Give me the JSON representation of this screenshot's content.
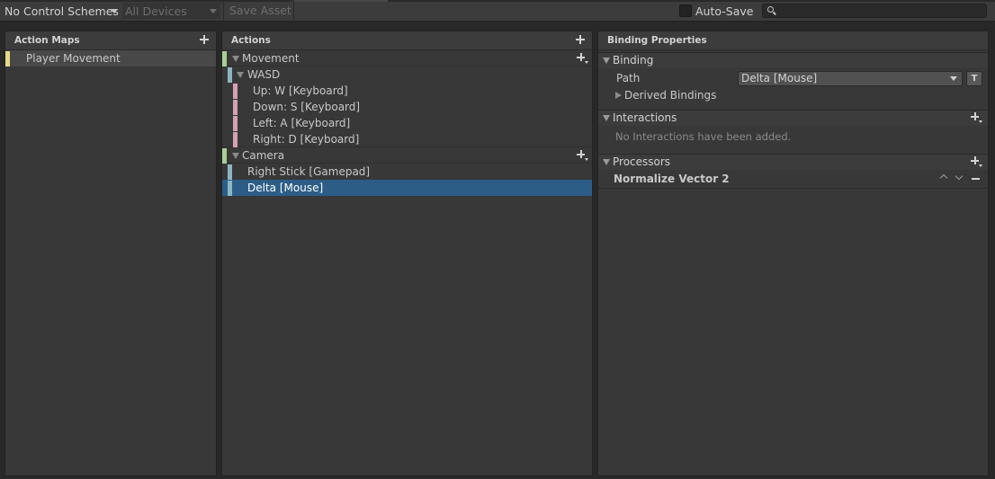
{
  "toolbar": {
    "control_scheme": "No Control Schemes",
    "devices": "All Devices",
    "save_asset": "Save Asset",
    "auto_save": "Auto-Save",
    "search_placeholder": ""
  },
  "action_maps": {
    "title": "Action Maps",
    "items": [
      {
        "label": "Player Movement",
        "color": "#e8d98a"
      }
    ]
  },
  "actions": {
    "title": "Actions",
    "rows": [
      {
        "label": "Movement",
        "kind": "action",
        "color": "#a8cf92"
      },
      {
        "label": "WASD",
        "kind": "composite",
        "color": "#8db6c3"
      },
      {
        "label": "Up: W [Keyboard]",
        "kind": "part",
        "color": "#d4a0b4"
      },
      {
        "label": "Down: S [Keyboard]",
        "kind": "part",
        "color": "#d4a0b4"
      },
      {
        "label": "Left: A [Keyboard]",
        "kind": "part",
        "color": "#d4a0b4"
      },
      {
        "label": "Right: D [Keyboard]",
        "kind": "part",
        "color": "#d4a0b4"
      },
      {
        "label": "Camera",
        "kind": "action",
        "color": "#a8cf92"
      },
      {
        "label": "Right Stick [Gamepad]",
        "kind": "binding",
        "color": "#8db6c3"
      },
      {
        "label": "Delta [Mouse]",
        "kind": "binding",
        "color": "#8db6c3",
        "selected": true
      }
    ]
  },
  "binding_properties": {
    "title": "Binding Properties",
    "binding_section": "Binding",
    "path_label": "Path",
    "path_value": "Delta [Mouse]",
    "t_button": "T",
    "derived_bindings": "Derived Bindings",
    "interactions_section": "Interactions",
    "interactions_empty": "No Interactions have been added.",
    "processors_section": "Processors",
    "processor_item": "Normalize Vector 2"
  },
  "colors": {
    "selection": "#2c5d87",
    "panel": "#383838",
    "background": "#282828"
  }
}
